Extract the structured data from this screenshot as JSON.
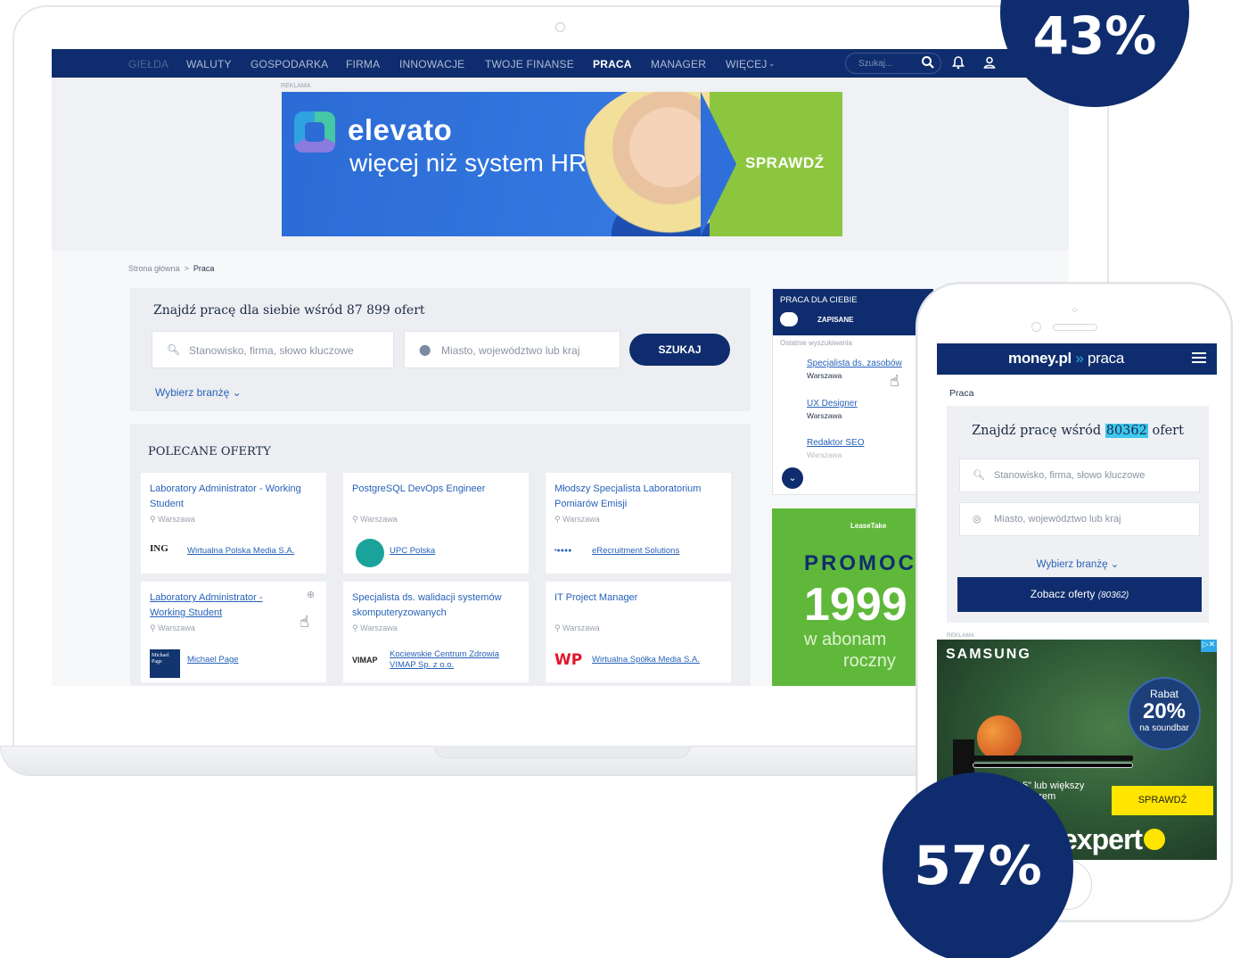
{
  "desktop": {
    "nav": {
      "items": [
        "GIEŁDA",
        "WALUTY",
        "GOSPODARKA",
        "FIRMA",
        "INNOWACJE",
        "TWOJE FINANSE",
        "PRACA",
        "MANAGER",
        "WIĘCEJ"
      ],
      "active": "PRACA",
      "search_placeholder": "Szukaj..."
    },
    "ad_label": "REKLAMA",
    "banner": {
      "brand": "elevato",
      "tagline": "więcej niż system HR",
      "cta": "SPRAWDŹ"
    },
    "breadcrumb": {
      "home": "Strona główna",
      "separator": ">",
      "current": "Praca"
    },
    "search": {
      "title": "Znajdź pracę dla siebie wśród 87 899 ofert",
      "position_placeholder": "Stanowisko, firma, słowo kluczowe",
      "location_placeholder": "Miasto, województwo lub kraj",
      "button": "SZUKAJ",
      "branch": "Wybierz branżę"
    },
    "offers": {
      "heading": "POLECANE OFERTY",
      "items": [
        {
          "title": "Laboratory Administrator - Working Student",
          "location": "Warszawa",
          "logo": "ING",
          "company": "Wirtualna Polska Media S.A."
        },
        {
          "title": "PostgreSQL DevOps Engineer",
          "location": "Warszawa",
          "logo": "",
          "company": "UPC Polska"
        },
        {
          "title": "Młodszy Specjalista Laboratorium Pomiarów Emisji",
          "location": "Warszawa",
          "logo": "",
          "company": "eRecruitment Solutions"
        },
        {
          "title": "Laboratory Administrator - Working Student",
          "location": "Warszawa",
          "logo": "Michael Page",
          "company": "Michael Page"
        },
        {
          "title": "Specjalista ds. walidacji systemów skomputeryzowanych",
          "location": "Warszawa",
          "logo": "VIMAP",
          "company": "Kociewskie Centrum Zdrowia VIMAP Sp. z o.o."
        },
        {
          "title": "IT Project Manager",
          "location": "Warszawa",
          "logo": "WP",
          "company": "Wirtualna Spółka Media S.A."
        }
      ]
    },
    "side": {
      "title": "PRACA DLA CIEBIE",
      "saved": "ZAPISANE",
      "recent_label": "Ostatnie wyszukiwania",
      "recent": [
        {
          "query": "Specjalista ds. zasobów",
          "location": "Warszawa"
        },
        {
          "query": "UX Designer",
          "location": "Warszawa"
        },
        {
          "query": "Redaktor SEO",
          "location": "Warszawa"
        }
      ]
    },
    "promo": {
      "brand": "LeaseTake",
      "line1": "PROMOC",
      "price": "1999",
      "line2": "w abonam",
      "line3": "roczny"
    }
  },
  "mobile": {
    "logo_left": "money.pl",
    "logo_right": "praca",
    "breadcrumb": "Praca",
    "title_before": "Znajdź pracę wśród",
    "title_count": "80362",
    "title_after": "ofert",
    "position_placeholder": "Stanowisko, firma, słowo kluczowe",
    "location_placeholder": "Miasto, województwo lub kraj",
    "branch": "Wybierz branżę",
    "button": "Zobacz oferty",
    "button_count": "(80362)",
    "ad_label": "REKLAMA",
    "ad": {
      "brand": "SAMSUNG",
      "discount_label": "Rabat",
      "discount": "20%",
      "discount_target": "na soundbar",
      "text1": "5\" lub większy",
      "text2": "dbarem",
      "cta": "SPRAWDŹ",
      "store": "expert"
    }
  },
  "stats": {
    "desktop_share": "43%",
    "mobile_share": "57%"
  },
  "colors": {
    "navy": "#0f2d6e",
    "link": "#2762b9",
    "highlight": "#3ec7f0",
    "green": "#8cc63f"
  }
}
